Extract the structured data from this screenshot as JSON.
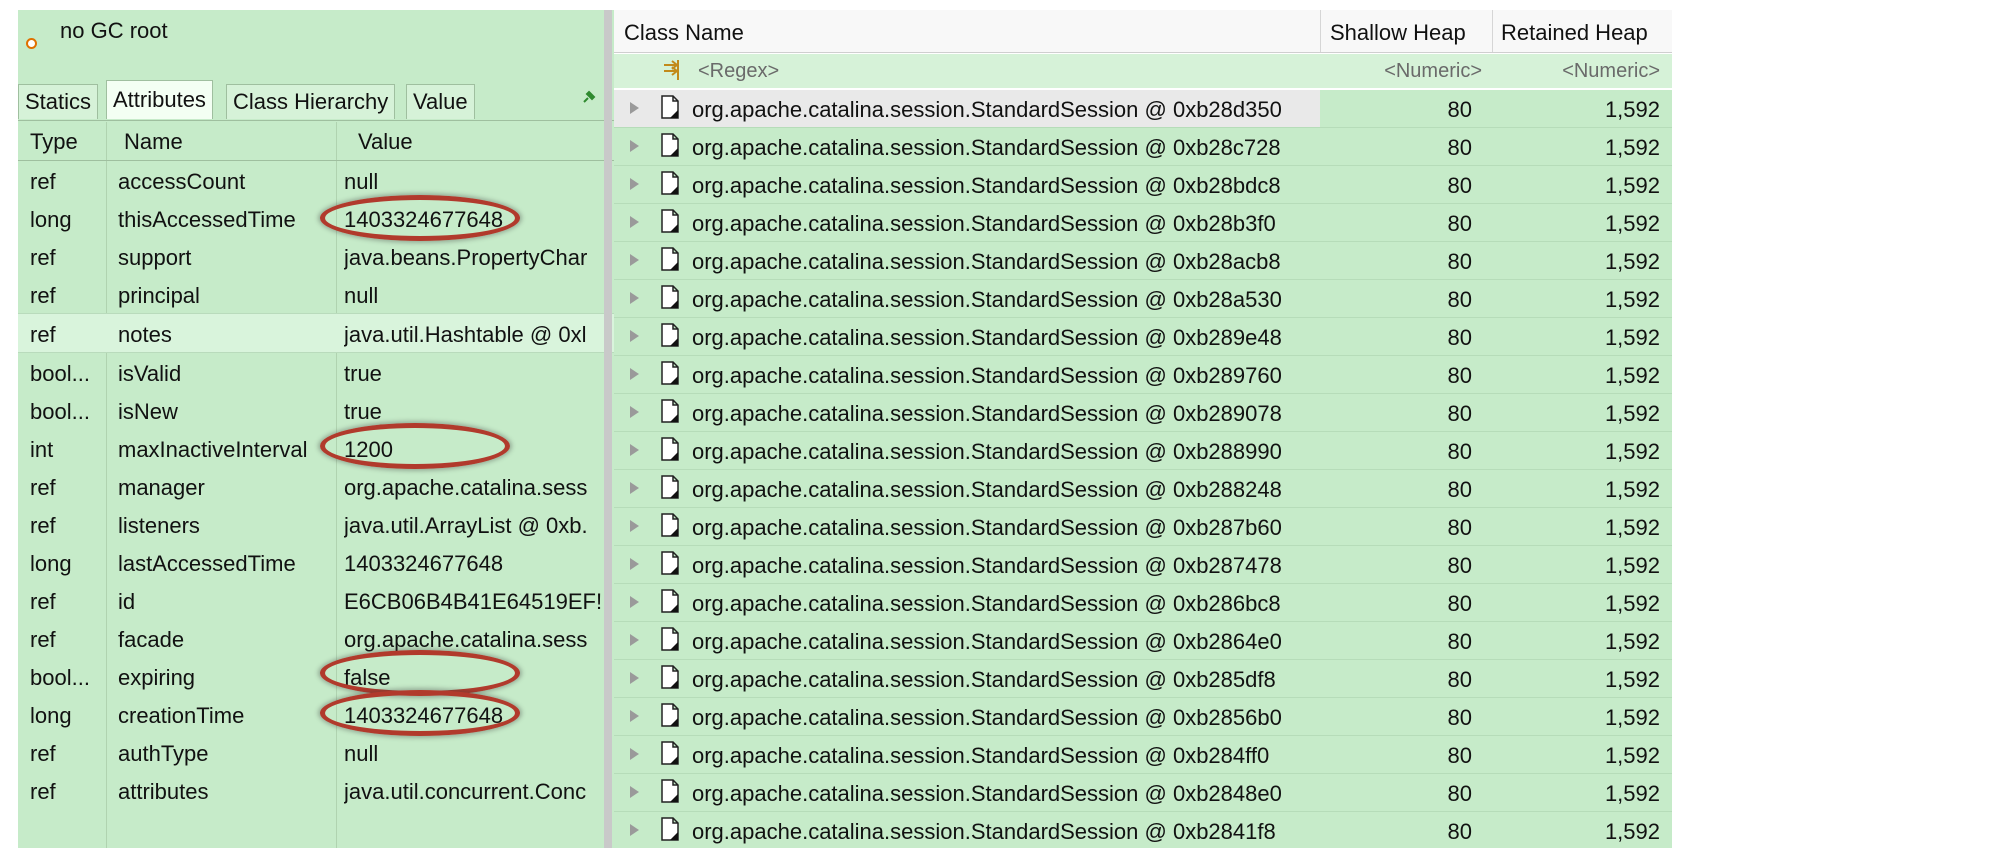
{
  "left_panel": {
    "gc_root_label": "no GC root",
    "tabs": [
      {
        "label": "Statics"
      },
      {
        "label": "Attributes"
      },
      {
        "label": "Class Hierarchy"
      },
      {
        "label": "Value"
      }
    ],
    "columns": {
      "type": "Type",
      "name": "Name",
      "value": "Value"
    },
    "rows": [
      {
        "type": "ref",
        "name": "accessCount",
        "value": "null"
      },
      {
        "type": "long",
        "name": "thisAccessedTime",
        "value": "1403324677648"
      },
      {
        "type": "ref",
        "name": "support",
        "value": "java.beans.PropertyChar"
      },
      {
        "type": "ref",
        "name": "principal",
        "value": "null"
      },
      {
        "type": "ref",
        "name": "notes",
        "value": "java.util.Hashtable @ 0xl"
      },
      {
        "type": "bool...",
        "name": "isValid",
        "value": "true"
      },
      {
        "type": "bool...",
        "name": "isNew",
        "value": "true"
      },
      {
        "type": "int",
        "name": "maxInactiveInterval",
        "value": "1200"
      },
      {
        "type": "ref",
        "name": "manager",
        "value": "org.apache.catalina.sess"
      },
      {
        "type": "ref",
        "name": "listeners",
        "value": "java.util.ArrayList @ 0xb."
      },
      {
        "type": "long",
        "name": "lastAccessedTime",
        "value": "1403324677648"
      },
      {
        "type": "ref",
        "name": "id",
        "value": "E6CB06B4B41E64519EF!"
      },
      {
        "type": "ref",
        "name": "facade",
        "value": "org.apache.catalina.sess"
      },
      {
        "type": "bool...",
        "name": "expiring",
        "value": "false"
      },
      {
        "type": "long",
        "name": "creationTime",
        "value": "1403324677648"
      },
      {
        "type": "ref",
        "name": "authType",
        "value": "null"
      },
      {
        "type": "ref",
        "name": "attributes",
        "value": "java.util.concurrent.Conc"
      }
    ]
  },
  "right_panel": {
    "columns": {
      "class_name": "Class Name",
      "shallow_heap": "Shallow Heap",
      "retained_heap": "Retained Heap"
    },
    "filter": {
      "regex": "<Regex>",
      "numeric1": "<Numeric>",
      "numeric2": "<Numeric>"
    },
    "rows": [
      {
        "name": "org.apache.catalina.session.StandardSession @ 0xb28d350",
        "shallow": "80",
        "retained": "1,592"
      },
      {
        "name": "org.apache.catalina.session.StandardSession @ 0xb28c728",
        "shallow": "80",
        "retained": "1,592"
      },
      {
        "name": "org.apache.catalina.session.StandardSession @ 0xb28bdc8",
        "shallow": "80",
        "retained": "1,592"
      },
      {
        "name": "org.apache.catalina.session.StandardSession @ 0xb28b3f0",
        "shallow": "80",
        "retained": "1,592"
      },
      {
        "name": "org.apache.catalina.session.StandardSession @ 0xb28acb8",
        "shallow": "80",
        "retained": "1,592"
      },
      {
        "name": "org.apache.catalina.session.StandardSession @ 0xb28a530",
        "shallow": "80",
        "retained": "1,592"
      },
      {
        "name": "org.apache.catalina.session.StandardSession @ 0xb289e48",
        "shallow": "80",
        "retained": "1,592"
      },
      {
        "name": "org.apache.catalina.session.StandardSession @ 0xb289760",
        "shallow": "80",
        "retained": "1,592"
      },
      {
        "name": "org.apache.catalina.session.StandardSession @ 0xb289078",
        "shallow": "80",
        "retained": "1,592"
      },
      {
        "name": "org.apache.catalina.session.StandardSession @ 0xb288990",
        "shallow": "80",
        "retained": "1,592"
      },
      {
        "name": "org.apache.catalina.session.StandardSession @ 0xb288248",
        "shallow": "80",
        "retained": "1,592"
      },
      {
        "name": "org.apache.catalina.session.StandardSession @ 0xb287b60",
        "shallow": "80",
        "retained": "1,592"
      },
      {
        "name": "org.apache.catalina.session.StandardSession @ 0xb287478",
        "shallow": "80",
        "retained": "1,592"
      },
      {
        "name": "org.apache.catalina.session.StandardSession @ 0xb286bc8",
        "shallow": "80",
        "retained": "1,592"
      },
      {
        "name": "org.apache.catalina.session.StandardSession @ 0xb2864e0",
        "shallow": "80",
        "retained": "1,592"
      },
      {
        "name": "org.apache.catalina.session.StandardSession @ 0xb285df8",
        "shallow": "80",
        "retained": "1,592"
      },
      {
        "name": "org.apache.catalina.session.StandardSession @ 0xb2856b0",
        "shallow": "80",
        "retained": "1,592"
      },
      {
        "name": "org.apache.catalina.session.StandardSession @ 0xb284ff0",
        "shallow": "80",
        "retained": "1,592"
      },
      {
        "name": "org.apache.catalina.session.StandardSession @ 0xb2848e0",
        "shallow": "80",
        "retained": "1,592"
      },
      {
        "name": "org.apache.catalina.session.StandardSession @ 0xb2841f8",
        "shallow": "80",
        "retained": "1,592"
      }
    ]
  },
  "colors": {
    "panel_green": "#c6ebc9",
    "highlight_ring": "#b13a2c"
  }
}
